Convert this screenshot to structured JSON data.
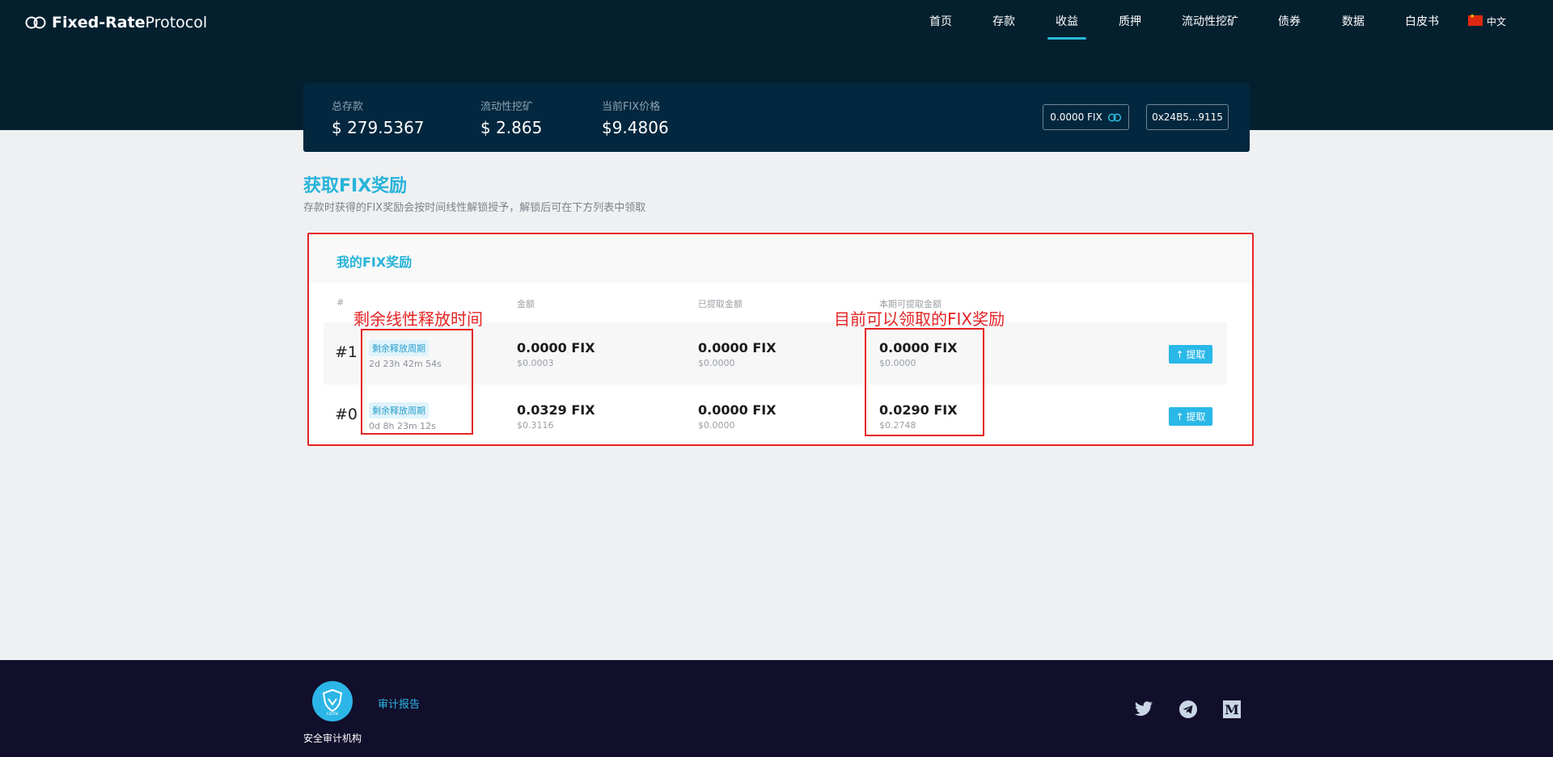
{
  "brand": {
    "name_bold": "Fixed-Rate",
    "name_light": "Protocol"
  },
  "nav": {
    "items": [
      {
        "label": "首页"
      },
      {
        "label": "存款"
      },
      {
        "label": "收益"
      },
      {
        "label": "质押"
      },
      {
        "label": "流动性挖矿"
      },
      {
        "label": "债券"
      },
      {
        "label": "数据"
      },
      {
        "label": "白皮书"
      }
    ],
    "active": "收益",
    "language": "中文"
  },
  "stats": {
    "total_deposit": {
      "label": "总存款",
      "value": "$ 279.5367"
    },
    "liquidity_mining": {
      "label": "流动性挖矿",
      "value": "$ 2.865"
    },
    "fix_price": {
      "label": "当前FIX价格",
      "value": "$9.4806"
    },
    "fix_balance": "0.0000 FIX",
    "wallet_address": "0x24B5...9115"
  },
  "page": {
    "title": "获取FIX奖励",
    "subtitle": "存款时获得的FIX奖励会按时间线性解锁授予，解锁后可在下方列表中领取"
  },
  "rewards": {
    "card_title": "我的FIX奖励",
    "columns": [
      "#",
      "金额",
      "已提取金额",
      "本期可提取金额"
    ],
    "tag_label": "剩余释放周期",
    "claim_label": "提取",
    "rows": [
      {
        "index": "#1",
        "remaining": "2d 23h 42m 54s",
        "amount": "0.0000 FIX",
        "amount_usd": "$0.0003",
        "withdrawn": "0.0000 FIX",
        "withdrawn_usd": "$0.0000",
        "claimable": "0.0000 FIX",
        "claimable_usd": "$0.0000"
      },
      {
        "index": "#0",
        "remaining": "0d 8h 23m 12s",
        "amount": "0.0329 FIX",
        "amount_usd": "$0.3116",
        "withdrawn": "0.0000 FIX",
        "withdrawn_usd": "$0.0000",
        "claimable": "0.0290 FIX",
        "claimable_usd": "$0.2748"
      }
    ]
  },
  "annotations": {
    "left": "剩余线性释放时间",
    "right": "目前可以领取的FIX奖励"
  },
  "footer": {
    "audit_link": "审计报告",
    "audit_caption": "安全审计机构",
    "certik_label": "CERTIK",
    "socials": [
      "twitter-icon",
      "telegram-icon",
      "medium-icon"
    ]
  },
  "colors": {
    "accent": "#27b3d9",
    "header_bg": "#04202f",
    "annotation_red": "#e52424",
    "footer_bg": "#110f2b"
  }
}
